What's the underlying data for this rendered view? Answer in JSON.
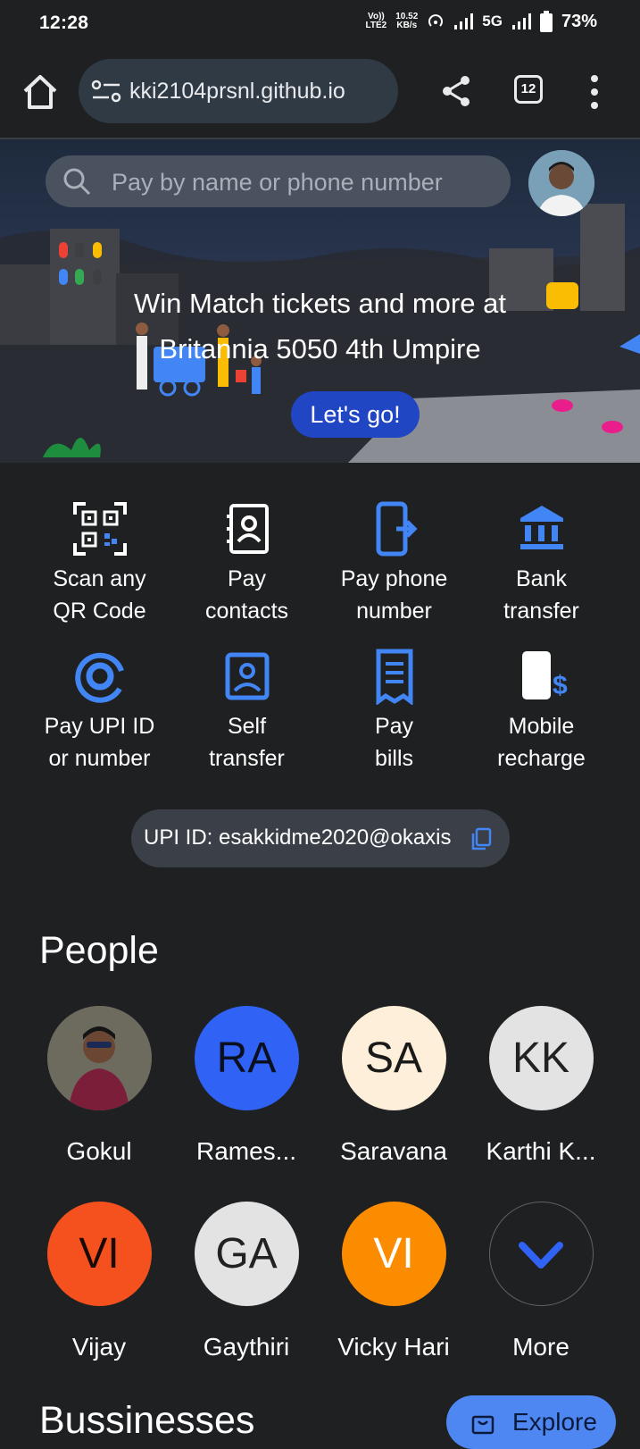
{
  "status_bar": {
    "time": "12:28",
    "volte": "Vo))",
    "lte": "LTE2",
    "speed_value": "10.52",
    "speed_unit": "KB/s",
    "network": "5G",
    "battery": "73%"
  },
  "browser": {
    "url": "kki2104prsnl.github.io",
    "tab_count": "12"
  },
  "search": {
    "placeholder": "Pay by name or phone number"
  },
  "banner": {
    "title_line1": "Win Match tickets and more at",
    "title_line2": "Britannia 5050 4th Umpire",
    "cta": "Let's go!"
  },
  "actions": [
    {
      "label1": "Scan any",
      "label2": "QR Code",
      "icon": "qr-code-icon"
    },
    {
      "label1": "Pay",
      "label2": "contacts",
      "icon": "contacts-book-icon"
    },
    {
      "label1": "Pay phone",
      "label2": "number",
      "icon": "phone-transfer-icon"
    },
    {
      "label1": "Bank",
      "label2": "transfer",
      "icon": "bank-icon"
    },
    {
      "label1": "Pay UPI ID",
      "label2": "or number",
      "icon": "at-sign-icon"
    },
    {
      "label1": "Self",
      "label2": "transfer",
      "icon": "self-transfer-icon"
    },
    {
      "label1": "Pay",
      "label2": "bills",
      "icon": "receipt-icon"
    },
    {
      "label1": "Mobile",
      "label2": "recharge",
      "icon": "mobile-recharge-icon"
    }
  ],
  "upi": {
    "text": "UPI ID: esakkidme2020@okaxis",
    "icon": "copy-icon"
  },
  "people": {
    "title": "People",
    "items": [
      {
        "name": "Gokul",
        "initials": ""
      },
      {
        "name": "Rames...",
        "initials": "RA",
        "bg": "#2f62f5",
        "fg": "#0b1020"
      },
      {
        "name": "Saravana",
        "initials": "SA",
        "bg": "#fdefd9",
        "fg": "#1a1a1a"
      },
      {
        "name": "Karthi K...",
        "initials": "KK",
        "bg": "#e3e3e3",
        "fg": "#222222"
      },
      {
        "name": "Vijay",
        "initials": "VI",
        "bg": "#f4511e",
        "fg": "#1a0a05"
      },
      {
        "name": "Gaythiri",
        "initials": "GA",
        "bg": "#e3e3e3",
        "fg": "#222222"
      },
      {
        "name": "Vicky Hari",
        "initials": "VI",
        "bg": "#fb8c00",
        "fg": "#ffffff"
      },
      {
        "name": "More",
        "initials": ""
      }
    ]
  },
  "businesses": {
    "title": "Bussinesses",
    "explore": "Explore"
  },
  "colors": {
    "accent_blue": "#4285f4",
    "background": "#1f2022"
  }
}
